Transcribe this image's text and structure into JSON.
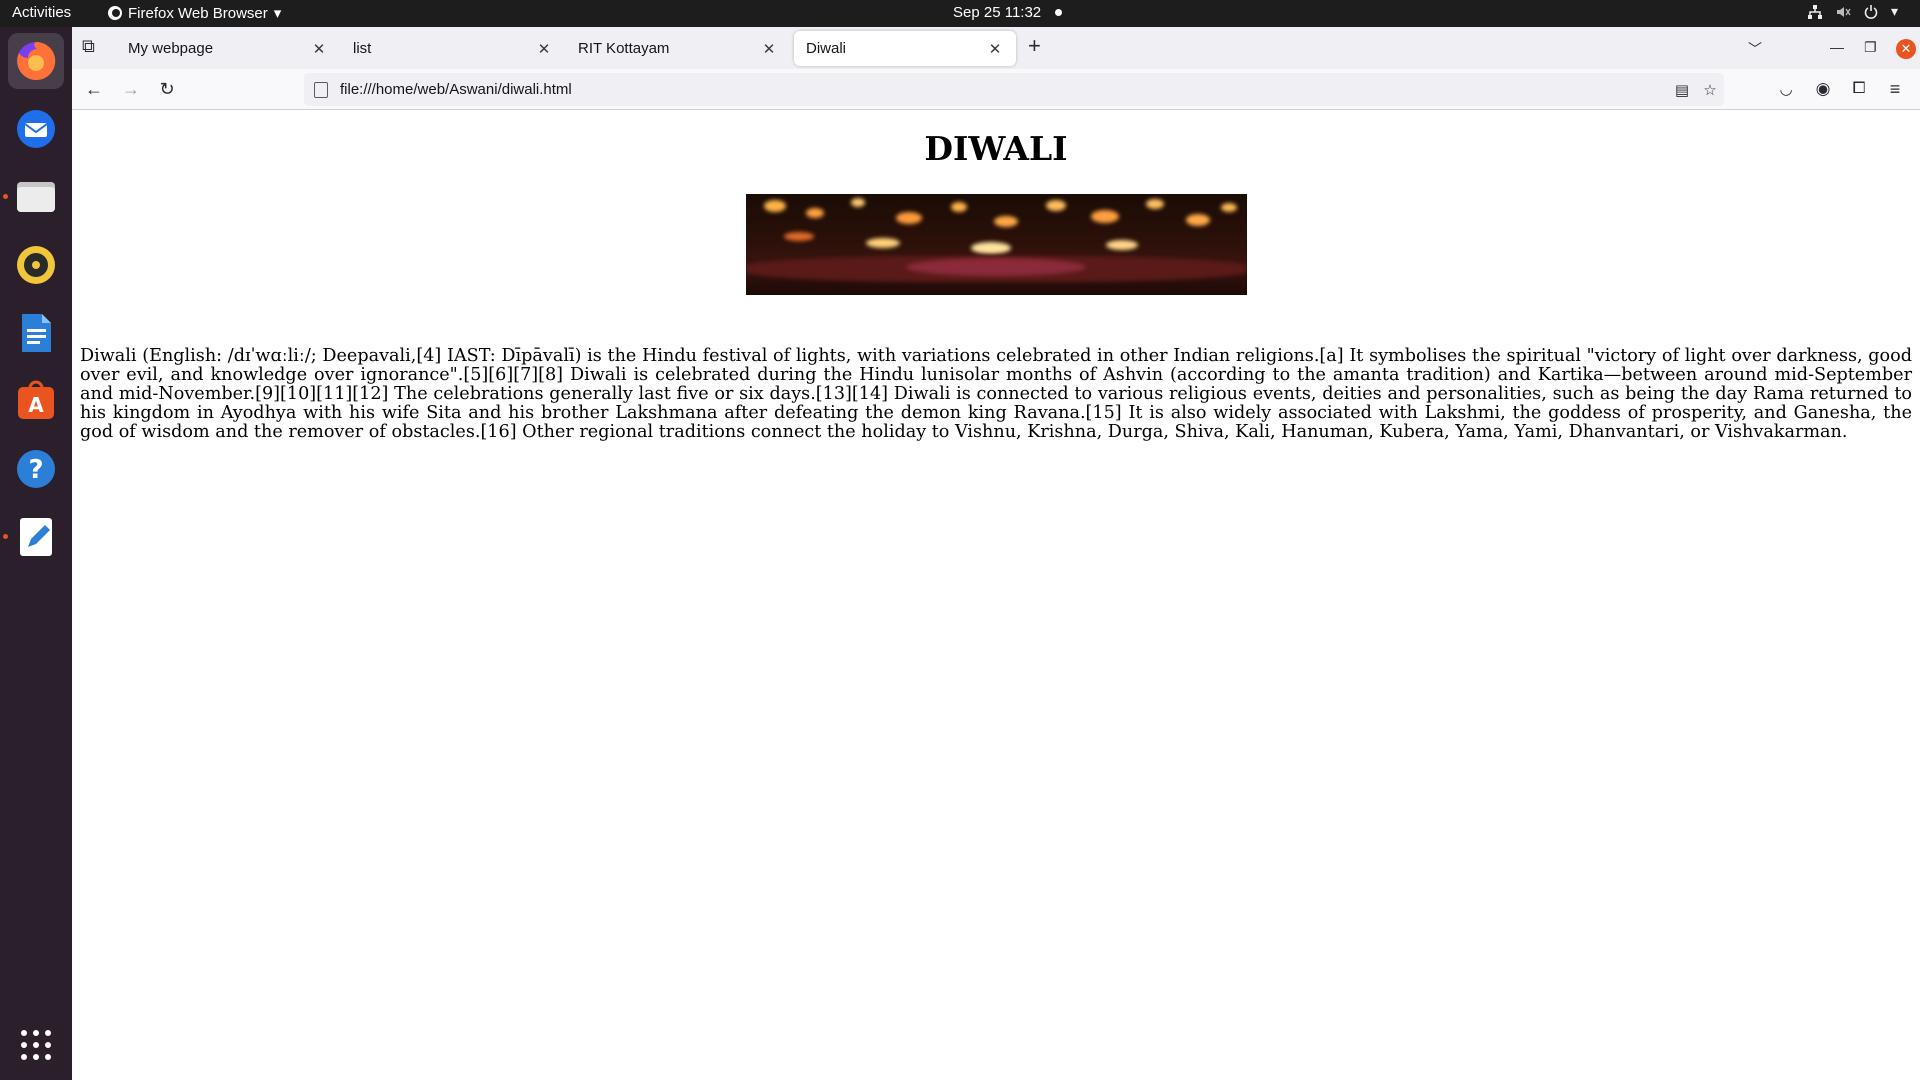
{
  "topbar": {
    "activities": "Activities",
    "app_name": "Firefox Web Browser",
    "date": "Sep 25",
    "time": "11:32"
  },
  "dock": {
    "items": [
      {
        "name": "Firefox Web Browser",
        "icon": "firefox-icon"
      },
      {
        "name": "Thunderbird Mail",
        "icon": "thunderbird-icon"
      },
      {
        "name": "Files",
        "icon": "files-icon"
      },
      {
        "name": "Rhythmbox",
        "icon": "rhythmbox-icon"
      },
      {
        "name": "LibreOffice Writer",
        "icon": "writer-icon"
      },
      {
        "name": "Ubuntu Software",
        "icon": "software-icon"
      },
      {
        "name": "Help",
        "icon": "help-icon"
      },
      {
        "name": "Text Editor",
        "icon": "text-editor-icon"
      },
      {
        "name": "Show Applications",
        "icon": "app-grid-icon"
      }
    ]
  },
  "tabs": [
    {
      "label": "My webpage"
    },
    {
      "label": "list"
    },
    {
      "label": "RIT Kottayam"
    },
    {
      "label": "Diwali"
    }
  ],
  "urlbar": {
    "url": "file:///home/web/Aswani/diwali.html"
  },
  "page": {
    "heading": "DIWALI",
    "paragraph": "Diwali (English: /dɪˈwɑːliː/; Deepavali,[4] IAST: Dīpāvalī) is the Hindu festival of lights, with variations celebrated in other Indian religions.[a] It symbolises the spiritual \"victory of light over darkness, good over evil, and knowledge over ignorance\".[5][6][7][8] Diwali is celebrated during the Hindu lunisolar months of Ashvin (according to the amanta tradition) and Kartika—between around mid-September and mid-November.[9][10][11][12] The celebrations generally last five or six days.[13][14] Diwali is connected to various religious events, deities and personalities, such as being the day Rama returned to his kingdom in Ayodhya with his wife Sita and his brother Lakshmana after defeating the demon king Ravana.[15] It is also widely associated with Lakshmi, the goddess of prosperity, and Ganesha, the god of wisdom and the remover of obstacles.[16] Other regional traditions connect the holiday to Vishnu, Krishna, Durga, Shiva, Kali, Hanuman, Kubera, Yama, Yami, Dhanvantari, or Vishvakarman."
  },
  "colors": {
    "topbar": "#1d1d1d",
    "dock": "#2b1f2c",
    "accent": "#e95420",
    "tabstrip": "#f0f0f4"
  }
}
